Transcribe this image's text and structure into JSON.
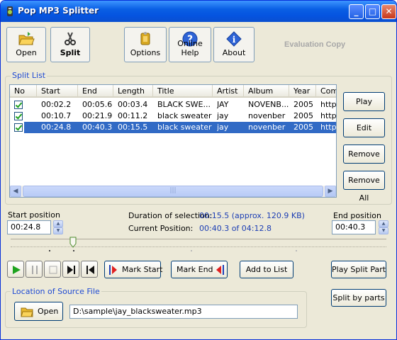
{
  "window": {
    "title": "Pop MP3 Splitter"
  },
  "toolbar": {
    "open_label": "Open",
    "split_label": "Split",
    "options_label": "Options",
    "help_label": "Online Help",
    "about_label": "About",
    "evaluation": "Evaluation Copy"
  },
  "split_list": {
    "title": "Split List",
    "columns": [
      "No",
      "Start",
      "End",
      "Length",
      "Title",
      "Artist",
      "Album",
      "Year",
      "Comm"
    ],
    "rows": [
      {
        "start": "00:02.2",
        "end": "00:05.6",
        "length": "00:03.4",
        "title": "BLACK SWE...",
        "artist": "JAY",
        "album": "NOVENB...",
        "year": "2005",
        "comment": "http://",
        "checked": true,
        "selected": false
      },
      {
        "start": "00:10.7",
        "end": "00:21.9",
        "length": "00:11.2",
        "title": "black sweater",
        "artist": "jay",
        "album": "novenber",
        "year": "2005",
        "comment": "http://",
        "checked": true,
        "selected": false
      },
      {
        "start": "00:24.8",
        "end": "00:40.3",
        "length": "00:15.5",
        "title": "black sweater",
        "artist": "jay",
        "album": "novenber",
        "year": "2005",
        "comment": "http://",
        "checked": true,
        "selected": true
      }
    ]
  },
  "side_buttons": {
    "play": "Play",
    "edit": "Edit",
    "remove": "Remove",
    "remove_all": "Remove All"
  },
  "position": {
    "start_label": "Start position",
    "start_value": "00:24.8",
    "end_label": "End position",
    "end_value": "00:40.3",
    "duration_label": "Duration of selection:",
    "duration_value": "00:15.5 (approx. 120.9 KB)",
    "current_label": "Current  Position:",
    "current_value": "00:40.3 of 04:12.8",
    "progress_fraction": 0.16
  },
  "transport": {
    "mark_start": "Mark Start",
    "mark_end": "Mark End",
    "add_to_list": "Add to List",
    "play_split_part": "Play Split Part",
    "split_by_parts": "Split by parts"
  },
  "source": {
    "title": "Location of Source File",
    "open_label": "Open",
    "path": "D:\\sample\\jay_blacksweater.mp3"
  }
}
